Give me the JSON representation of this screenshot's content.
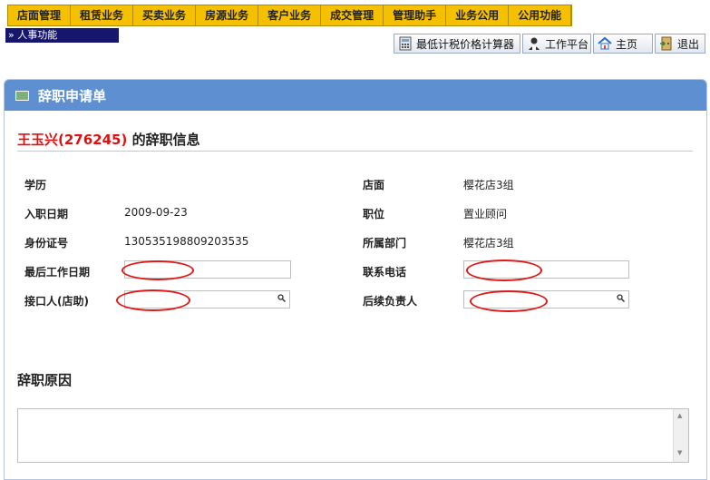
{
  "menu": [
    "店面管理",
    "租赁业务",
    "买卖业务",
    "房源业务",
    "客户业务",
    "成交管理",
    "管理助手",
    "业务公用",
    "公用功能"
  ],
  "breadcrumb": "»  人事功能",
  "toolbar": {
    "calc": "最低计税价格计算器",
    "workbench": "工作平台",
    "home": "主页",
    "logout": "退出"
  },
  "panel_title": "辞职申请单",
  "header": {
    "name": "王玉兴(276245)",
    "suffix": " 的辞职信息"
  },
  "fields": {
    "education_label": "学历",
    "education_value": "",
    "store_label": "店面",
    "store_value": "樱花店3组",
    "hire_label": "入职日期",
    "hire_value": "2009-09-23",
    "position_label": "职位",
    "position_value": "置业顾问",
    "id_label": "身份证号",
    "id_value": "130535198809203535",
    "dept_label": "所属部门",
    "dept_value": "樱花店3组",
    "lastday_label": "最后工作日期",
    "lastday_value": "",
    "phone_label": "联系电话",
    "phone_value": "",
    "receiver_label": "接口人(店助)",
    "receiver_value": "",
    "followup_label": "后续负责人",
    "followup_value": ""
  },
  "reason_title": "辞职原因",
  "reason_value": "",
  "colors": {
    "menubar": "#f5c000",
    "panel_header": "#5d8fd1",
    "highlight": "#e01010"
  }
}
